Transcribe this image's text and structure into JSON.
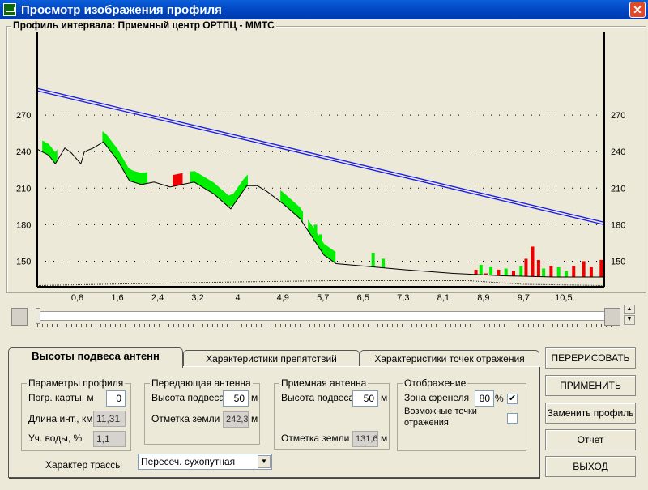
{
  "window": {
    "title": "Просмотр изображения профиля",
    "close": "✕"
  },
  "frame_title": "Профиль интервала: Приемный центр ОРТПЦ - ММТС",
  "chart_data": {
    "type": "line",
    "title": "Профиль интервала: Приемный центр ОРТПЦ - ММТС",
    "xlim": [
      0,
      11.31
    ],
    "ylim": [
      129,
      338
    ],
    "x_ticks": [
      "0,8",
      "1,6",
      "2,4",
      "3,2",
      "4",
      "4,9",
      "5,7",
      "6,5",
      "7,3",
      "8,1",
      "8,9",
      "9,7",
      "10,5"
    ],
    "x_tick_values": [
      0.8,
      1.6,
      2.4,
      3.2,
      4.0,
      4.9,
      5.7,
      6.5,
      7.3,
      8.1,
      8.9,
      9.7,
      10.5
    ],
    "y_ticks": [
      150,
      180,
      210,
      240,
      270
    ],
    "y_tick_labels": [
      "150",
      "180",
      "210",
      "240",
      "270"
    ],
    "grid": "dotted-horizontal",
    "terrain": [
      [
        0,
        242
      ],
      [
        0.23,
        237
      ],
      [
        0.36,
        230
      ],
      [
        0.55,
        243
      ],
      [
        0.68,
        239
      ],
      [
        0.87,
        230
      ],
      [
        0.94,
        240
      ],
      [
        1.12,
        243
      ],
      [
        1.32,
        248
      ],
      [
        1.6,
        233
      ],
      [
        1.84,
        216
      ],
      [
        2.08,
        213
      ],
      [
        2.33,
        215
      ],
      [
        2.65,
        211
      ],
      [
        2.89,
        213
      ],
      [
        3.13,
        215
      ],
      [
        3.53,
        205
      ],
      [
        3.86,
        193
      ],
      [
        4.18,
        212
      ],
      [
        4.39,
        212
      ],
      [
        4.59,
        207
      ],
      [
        4.91,
        197
      ],
      [
        5.24,
        185
      ],
      [
        5.48,
        170
      ],
      [
        5.72,
        155
      ],
      [
        5.96,
        148
      ],
      [
        6.52,
        146
      ],
      [
        7.33,
        143
      ],
      [
        8.3,
        140
      ],
      [
        9.3,
        138
      ],
      [
        10.3,
        137
      ],
      [
        11.31,
        137
      ]
    ],
    "ground_base": [
      [
        0,
        130
      ],
      [
        1.3,
        131
      ],
      [
        2.6,
        132
      ],
      [
        4.0,
        133
      ],
      [
        5.9,
        134
      ],
      [
        8.6,
        134
      ],
      [
        9.7,
        131
      ],
      [
        11.31,
        130
      ]
    ],
    "los_upper": [
      [
        0,
        292
      ],
      [
        11.31,
        182
      ]
    ],
    "los_lower": [
      [
        0,
        290
      ],
      [
        11.31,
        180
      ]
    ],
    "fresnel_green": [
      [
        0.1,
        0.4
      ],
      [
        1.3,
        2.2
      ],
      [
        3.05,
        4.2
      ],
      [
        4.85,
        5.3
      ],
      [
        5.4,
        5.95
      ]
    ],
    "fresnel_red": [
      [
        2.7,
        2.9
      ]
    ],
    "bars": [
      [
        5.55,
        180,
        "green"
      ],
      [
        5.65,
        172,
        "green"
      ],
      [
        6.7,
        157,
        "green"
      ],
      [
        6.9,
        152,
        "green"
      ],
      [
        8.75,
        143,
        "red"
      ],
      [
        8.85,
        147,
        "green"
      ],
      [
        8.95,
        140,
        "red"
      ],
      [
        9.05,
        145,
        "green"
      ],
      [
        9.2,
        143,
        "red"
      ],
      [
        9.35,
        144,
        "green"
      ],
      [
        9.5,
        142,
        "red"
      ],
      [
        9.65,
        146,
        "green"
      ],
      [
        9.75,
        152,
        "red"
      ],
      [
        9.88,
        162,
        "red"
      ],
      [
        10.0,
        151,
        "red"
      ],
      [
        10.1,
        144,
        "green"
      ],
      [
        10.25,
        146,
        "red"
      ],
      [
        10.4,
        145,
        "green"
      ],
      [
        10.55,
        142,
        "green"
      ],
      [
        10.7,
        146,
        "red"
      ],
      [
        10.9,
        150,
        "red"
      ],
      [
        11.05,
        145,
        "red"
      ],
      [
        11.25,
        151,
        "red"
      ]
    ]
  },
  "tabs": [
    {
      "label": "Высоты подвеса антенн"
    },
    {
      "label": "Характеристики препятствий"
    },
    {
      "label": "Характеристики точек отражения"
    }
  ],
  "profile": {
    "legend": "Параметры профиля",
    "map_error_label": "Погр. карты, м",
    "map_error": "0",
    "length_label": "Длина инт., км",
    "length": "11,31",
    "water_label": "Уч. воды, %",
    "water": "1,1"
  },
  "tx": {
    "legend": "Передающая антенна",
    "height_label": "Высота подвеса",
    "height": "50",
    "height_unit": "м",
    "ground_label": "Отметка земли",
    "ground": "242,3",
    "ground_unit": "м"
  },
  "rx": {
    "legend": "Приемная антенна",
    "height_label": "Высота подвеса",
    "height": "50",
    "height_unit": "м",
    "ground_label": "Отметка земли",
    "ground": "131,6",
    "ground_unit": "м"
  },
  "display": {
    "legend": "Отображение",
    "fresnel_label": "Зона френеля",
    "fresnel": "80",
    "fresnel_unit": "%",
    "fresnel_checked": "✔",
    "reflect_label1": "Возможные точки",
    "reflect_label2": "отражения"
  },
  "route": {
    "label": "Характер трассы",
    "value": "Пересеч. сухопутная"
  },
  "buttons": {
    "redraw": "ПЕРЕРИСОВАТЬ",
    "apply": "ПРИМЕНИТЬ",
    "replace": "Заменить профиль",
    "report": "Отчет",
    "exit": "ВЫХОД"
  }
}
